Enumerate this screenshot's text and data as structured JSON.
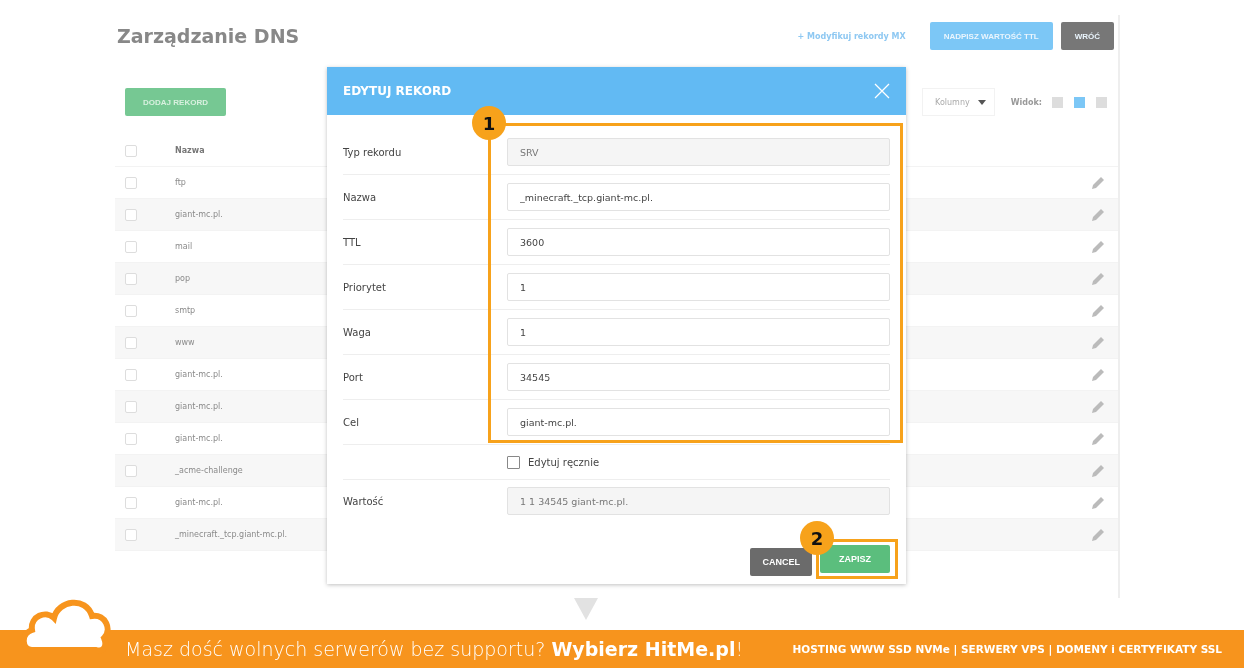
{
  "page": {
    "title": "Zarządzanie DNS",
    "mx_link": "+ Modyfikuj rekordy MX",
    "buttons": [
      {
        "label": "NADPISZ WARTOŚĆ TTL",
        "kind": "primary"
      },
      {
        "label": "WRÓĆ",
        "kind": "secondary"
      }
    ],
    "add_button": "DODAJ REKORD",
    "columns_select": "Kolumny",
    "view_label": "Widok:",
    "view_options": [
      {
        "selected": false
      },
      {
        "selected": true
      },
      {
        "selected": false
      }
    ],
    "table": {
      "columns": [
        "Nazwa"
      ],
      "header_checked": false,
      "rows": [
        {
          "name": "ftp",
          "checked": false
        },
        {
          "name": "giant-mc.pl.",
          "checked": false
        },
        {
          "name": "mail",
          "checked": false
        },
        {
          "name": "pop",
          "checked": false
        },
        {
          "name": "smtp",
          "checked": false
        },
        {
          "name": "www",
          "checked": false
        },
        {
          "name": "giant-mc.pl.",
          "checked": false
        },
        {
          "name": "giant-mc.pl.",
          "checked": false
        },
        {
          "name": "giant-mc.pl.",
          "checked": false
        },
        {
          "name": "_acme-challenge",
          "checked": false
        },
        {
          "name": "giant-mc.pl.",
          "checked": false
        },
        {
          "name": "_minecraft._tcp.giant-mc.pl.",
          "checked": false
        }
      ]
    }
  },
  "dialog": {
    "title": "EDYTUJ REKORD",
    "fields_marker": "1",
    "save_marker": "2",
    "fields": [
      {
        "label": "Typ rekordu",
        "value": "SRV",
        "disabled": true
      },
      {
        "label": "Nazwa",
        "value": "_minecraft._tcp.giant-mc.pl.",
        "disabled": false
      },
      {
        "label": "TTL",
        "value": "3600",
        "disabled": false
      },
      {
        "label": "Priorytet",
        "value": "1",
        "disabled": false
      },
      {
        "label": "Waga",
        "value": "1",
        "disabled": false
      },
      {
        "label": "Port",
        "value": "34545",
        "disabled": false
      },
      {
        "label": "Cel",
        "value": "giant-mc.pl.",
        "disabled": false
      }
    ],
    "manual_edit": {
      "label": "Edytuj ręcznie",
      "checked": false
    },
    "value_field": {
      "label": "Wartość",
      "value": "1 1 34545 giant-mc.pl.",
      "disabled": true
    },
    "buttons": [
      {
        "label": "CANCEL",
        "kind": "cancel"
      },
      {
        "label": "ZAPISZ",
        "kind": "save"
      }
    ]
  },
  "banner": {
    "text": "Masz dość wolnych serwerów bez supportu? **Wybierz HitMe.pl**!",
    "services": "HOSTING WWW SSD NVMe | SERWERY VPS | DOMENY i CERTYFIKATY SSL"
  }
}
